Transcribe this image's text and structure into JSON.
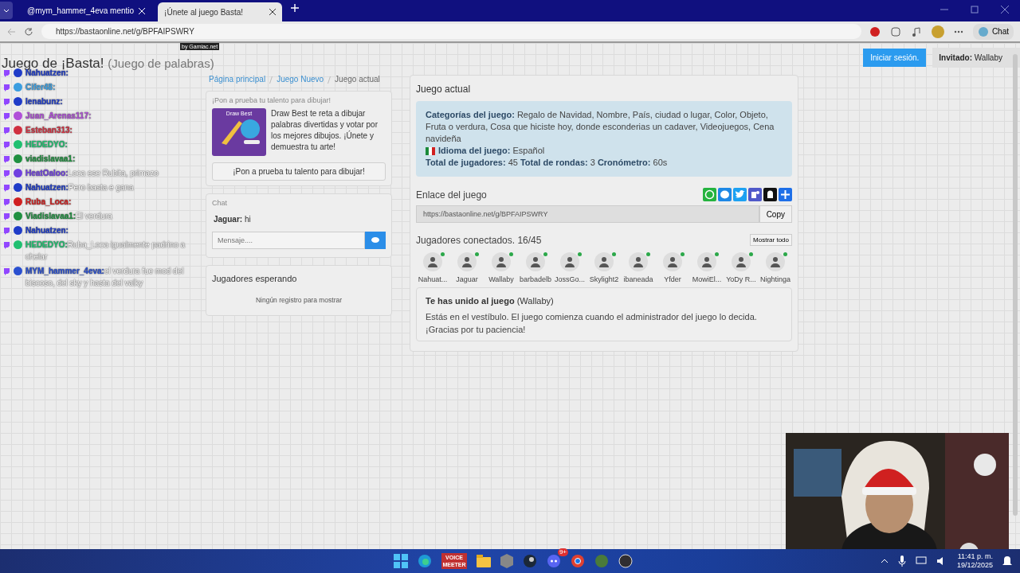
{
  "browser": {
    "tabs": [
      {
        "title": "@mym_hammer_4eva mentio",
        "selected": false
      },
      {
        "title": "¡Únete al juego Basta!",
        "selected": true
      }
    ],
    "url": "https://bastaonline.net/g/BPFAIPSWRY",
    "chat_button": "Chat"
  },
  "header": {
    "title": "Juego de ¡Basta!",
    "subtitle": "(Juego de palabras)",
    "login": "Iniciar sesión.",
    "guest_label": "Invitado:",
    "guest_name": "Wallaby"
  },
  "overlay_tag": "by Gamiac.net",
  "stream_chat": [
    {
      "name": "Nahuatzen:",
      "color": "#1f3cc8"
    },
    {
      "name": "Cifer48:",
      "color": "#3a9ee0"
    },
    {
      "name": "Ienabunz:",
      "color": "#1f3cc8"
    },
    {
      "name": "Juan_Arenas117:",
      "color": "#b050d8"
    },
    {
      "name": "Esteban313:",
      "color": "#d03040"
    },
    {
      "name": "HEDEDYO:",
      "color": "#20c070"
    },
    {
      "name": "viadislavaa1:",
      "color": "#209040"
    },
    {
      "name": "HeatOaloo:",
      "message": "Loca ese Rubita, primazo",
      "color": "#7040e0"
    },
    {
      "name": "Nahuatzen:",
      "message": "Pero basta e gana",
      "color": "#1f3cc8"
    },
    {
      "name": "Ruba_Loca:",
      "color": "#d02020"
    },
    {
      "name": "Viadislavaa1:",
      "message": "El verdura",
      "color": "#209040"
    },
    {
      "name": "Nahuatzen:",
      "color": "#1f3cc8"
    },
    {
      "name": "HEDEDYO:",
      "message": "Ruba_Loca igualmente padrino a chelar",
      "color": "#20c070"
    },
    {
      "name": "MYM_hammer_4eva:",
      "message": "el verdura fue mod del biscoso, del sky y hasta del valky",
      "color": "#2a50d0"
    }
  ],
  "breadcrumb": [
    {
      "label": "Página principal",
      "current": false
    },
    {
      "label": "Juego Nuevo",
      "current": false
    },
    {
      "label": "Juego actual",
      "current": true
    }
  ],
  "promo": {
    "heading": "¡Pon a prueba tu talento para dibujar!",
    "image_title": "Draw Best",
    "text": "Draw Best te reta a dibujar palabras divertidas y votar por los mejores dibujos. ¡Únete y demuestra tu arte!",
    "button": "¡Pon a prueba tu talento para dibujar!"
  },
  "chat": {
    "title": "Chat",
    "messages": [
      {
        "author": "Jaguar:",
        "text": "hi"
      }
    ],
    "placeholder": "Mensaje...."
  },
  "waiting": {
    "title": "Jugadores esperando",
    "empty": "Ningún registro para mostrar"
  },
  "game": {
    "title": "Juego actual",
    "info_lines": [
      [
        {
          "kind": "text",
          "label": "Categorías del juego:",
          "value": "Regalo de Navidad, Nombre, País, ciudad o lugar, Color, Objeto, Fruta o verdura, Cosa que hiciste hoy, donde esconderias un cadaver, Videojuegos, Cena navideña"
        }
      ],
      [
        {
          "kind": "language",
          "label": "Idioma del juego:",
          "value": "Español"
        }
      ],
      [
        {
          "kind": "text",
          "label": "Total de jugadores:",
          "value": "45"
        },
        {
          "kind": "text",
          "label": "Total de rondas:",
          "value": "3"
        },
        {
          "kind": "text",
          "label": "Cronómetro:",
          "value": "60s"
        }
      ]
    ],
    "link_title": "Enlace del juego",
    "link": "https://bastaonline.net/g/BPFAIPSWRY",
    "copy": "Copy",
    "players_title": "Jugadores conectados. 16/45",
    "show_all": "Mostrar todo",
    "players": [
      {
        "name": "Nahuat...",
        "online": true
      },
      {
        "name": "Jaguar",
        "online": true
      },
      {
        "name": "Wallaby",
        "online": true
      },
      {
        "name": "barbadelb",
        "online": true
      },
      {
        "name": "JossGo...",
        "online": true
      },
      {
        "name": "Skylight2",
        "online": true
      },
      {
        "name": "ibaneada",
        "online": true
      },
      {
        "name": "Yfder",
        "online": true
      },
      {
        "name": "MowiEl...",
        "online": true
      },
      {
        "name": "YoDy R...",
        "online": true
      },
      {
        "name": "Nightinga",
        "online": true
      }
    ],
    "notice": {
      "title": "Te has unido al juego",
      "name": "(Wallaby)",
      "text": "Estás en el vestíbulo. El juego comienza cuando el administrador del juego lo decida. ¡Gracias por tu paciencia!"
    }
  },
  "taskbar": {
    "voice_label": "VOICE MEETER",
    "badge": "9+",
    "time": "11:41 p. m.",
    "date": "19/12/2025"
  }
}
